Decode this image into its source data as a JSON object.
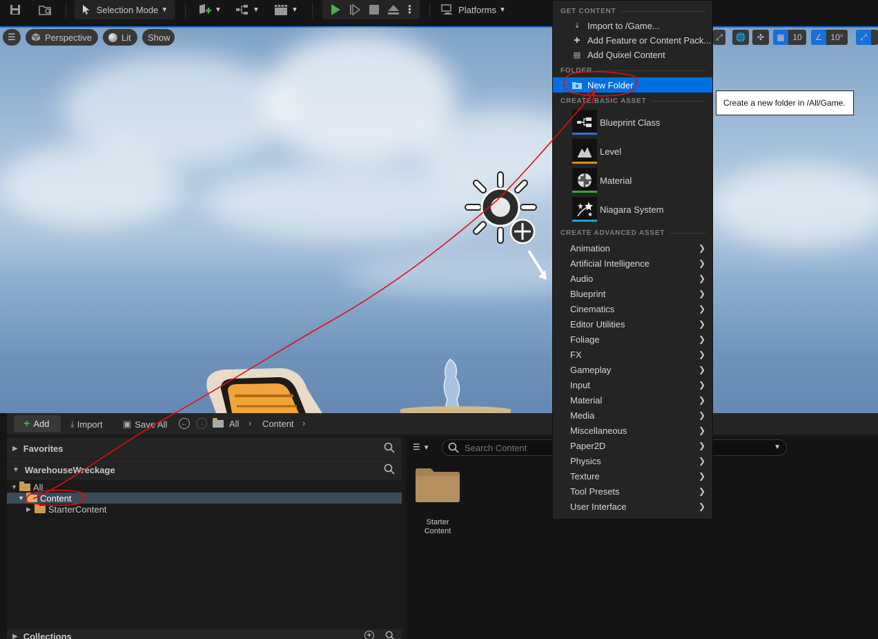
{
  "toolbar": {
    "selection_mode_label": "Selection Mode",
    "platforms_label": "Platforms"
  },
  "viewport": {
    "perspective_label": "Perspective",
    "lit_label": "Lit",
    "show_label": "Show",
    "grid_snap_value": "10",
    "rotation_snap_value": "10°"
  },
  "content_browser": {
    "add_label": "Add",
    "import_label": "Import",
    "save_all_label": "Save All",
    "breadcrumb": [
      "All",
      "Content"
    ],
    "favorites_label": "Favorites",
    "project_label": "WarehouseWreckage",
    "tree": [
      {
        "label": "All"
      },
      {
        "label": "Content"
      },
      {
        "label": "StarterContent"
      }
    ],
    "collections_label": "Collections",
    "search_placeholder": "Search Content",
    "assets": [
      {
        "label_line1": "Starter",
        "label_line2": "Content"
      }
    ]
  },
  "menu": {
    "get_content_header": "GET CONTENT",
    "get_content_items": [
      {
        "label": "Import to /Game...",
        "icon": "import-icon"
      },
      {
        "label": "Add Feature or Content Pack...",
        "icon": "feature-pack-icon"
      },
      {
        "label": "Add Quixel Content",
        "icon": "quixel-icon"
      }
    ],
    "folder_header": "FOLDER",
    "new_folder_label": "New Folder",
    "basic_header": "CREATE BASIC ASSET",
    "basic_items": [
      {
        "label": "Blueprint Class",
        "color": "#3a6fd8",
        "icon": "blueprint-class-icon"
      },
      {
        "label": "Level",
        "color": "#e08a19",
        "icon": "level-icon"
      },
      {
        "label": "Material",
        "color": "#3aa83a",
        "icon": "material-icon"
      },
      {
        "label": "Niagara System",
        "color": "#1aa5d8",
        "icon": "niagara-icon"
      }
    ],
    "advanced_header": "CREATE ADVANCED ASSET",
    "advanced_items": [
      "Animation",
      "Artificial Intelligence",
      "Audio",
      "Blueprint",
      "Cinematics",
      "Editor Utilities",
      "Foliage",
      "FX",
      "Gameplay",
      "Input",
      "Material",
      "Media",
      "Miscellaneous",
      "Paper2D",
      "Physics",
      "Texture",
      "Tool Presets",
      "User Interface"
    ]
  },
  "tooltip": {
    "text": "Create a new folder in /All/Game."
  },
  "colors": {
    "selection": "#0070e0",
    "annotation": "#e01010",
    "play": "#4caf50"
  }
}
